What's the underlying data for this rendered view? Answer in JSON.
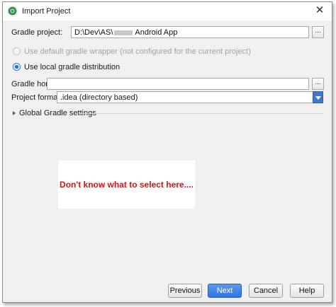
{
  "window": {
    "title": "Import Project",
    "close_glyph": "✕"
  },
  "gradle_project": {
    "label": "Gradle project:",
    "value": "D:\\Dev\\AS\\",
    "value_suffix": "Android App",
    "browse_label": "..."
  },
  "options": {
    "default_wrapper": "Use default gradle wrapper (not configured for the current project)",
    "local_distribution": "Use local gradle distribution"
  },
  "gradle_home": {
    "label": "Gradle home:",
    "value": "",
    "browse_label": "..."
  },
  "project_format": {
    "label": "Project format:",
    "value": ".idea (directory based)"
  },
  "global_settings": {
    "label": "Global Gradle settings"
  },
  "annotation": {
    "text": "Don't know what to select here...."
  },
  "buttons": {
    "previous": "Previous",
    "next": "Next",
    "cancel": "Cancel",
    "help": "Help"
  },
  "colors": {
    "accent": "#3c78d8",
    "annotation_text": "#e01010"
  }
}
